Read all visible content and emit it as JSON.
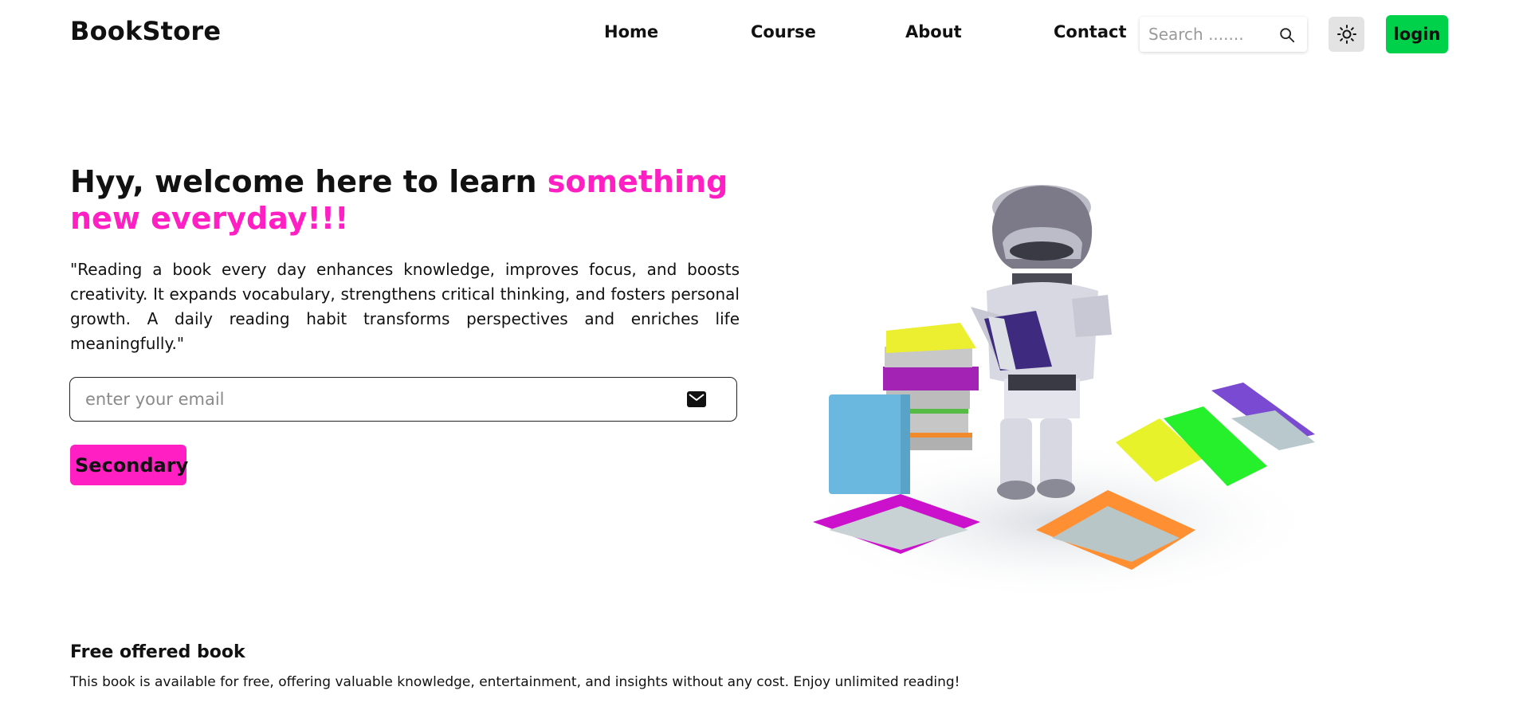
{
  "navbar": {
    "brand": "BookStore",
    "links": [
      "Home",
      "Course",
      "About",
      "Contact"
    ],
    "search": {
      "placeholder": "Search ......."
    },
    "theme_icon": "sun-icon",
    "login_label": "login",
    "login_color": "#00d14b"
  },
  "hero": {
    "title_plain": "Hyy, welcome here to learn ",
    "title_accent": "something new everyday!!!",
    "accent_color": "#ff1fc3",
    "description": "\"Reading a book every day enhances knowledge, improves focus, and boosts creativity. It expands vocabulary, strengthens critical thinking, and fosters personal growth. A daily reading habit transforms perspectives and enriches life meaningfully.\"",
    "email": {
      "placeholder": "enter your email",
      "icon": "mail-icon"
    },
    "secondary_label": "Secondary",
    "illustration": "robot-reading-books-illustration"
  },
  "free_section": {
    "title": "Free offered book",
    "description": "This book is available for free, offering valuable knowledge, entertainment, and insights without any cost. Enjoy unlimited reading!"
  }
}
